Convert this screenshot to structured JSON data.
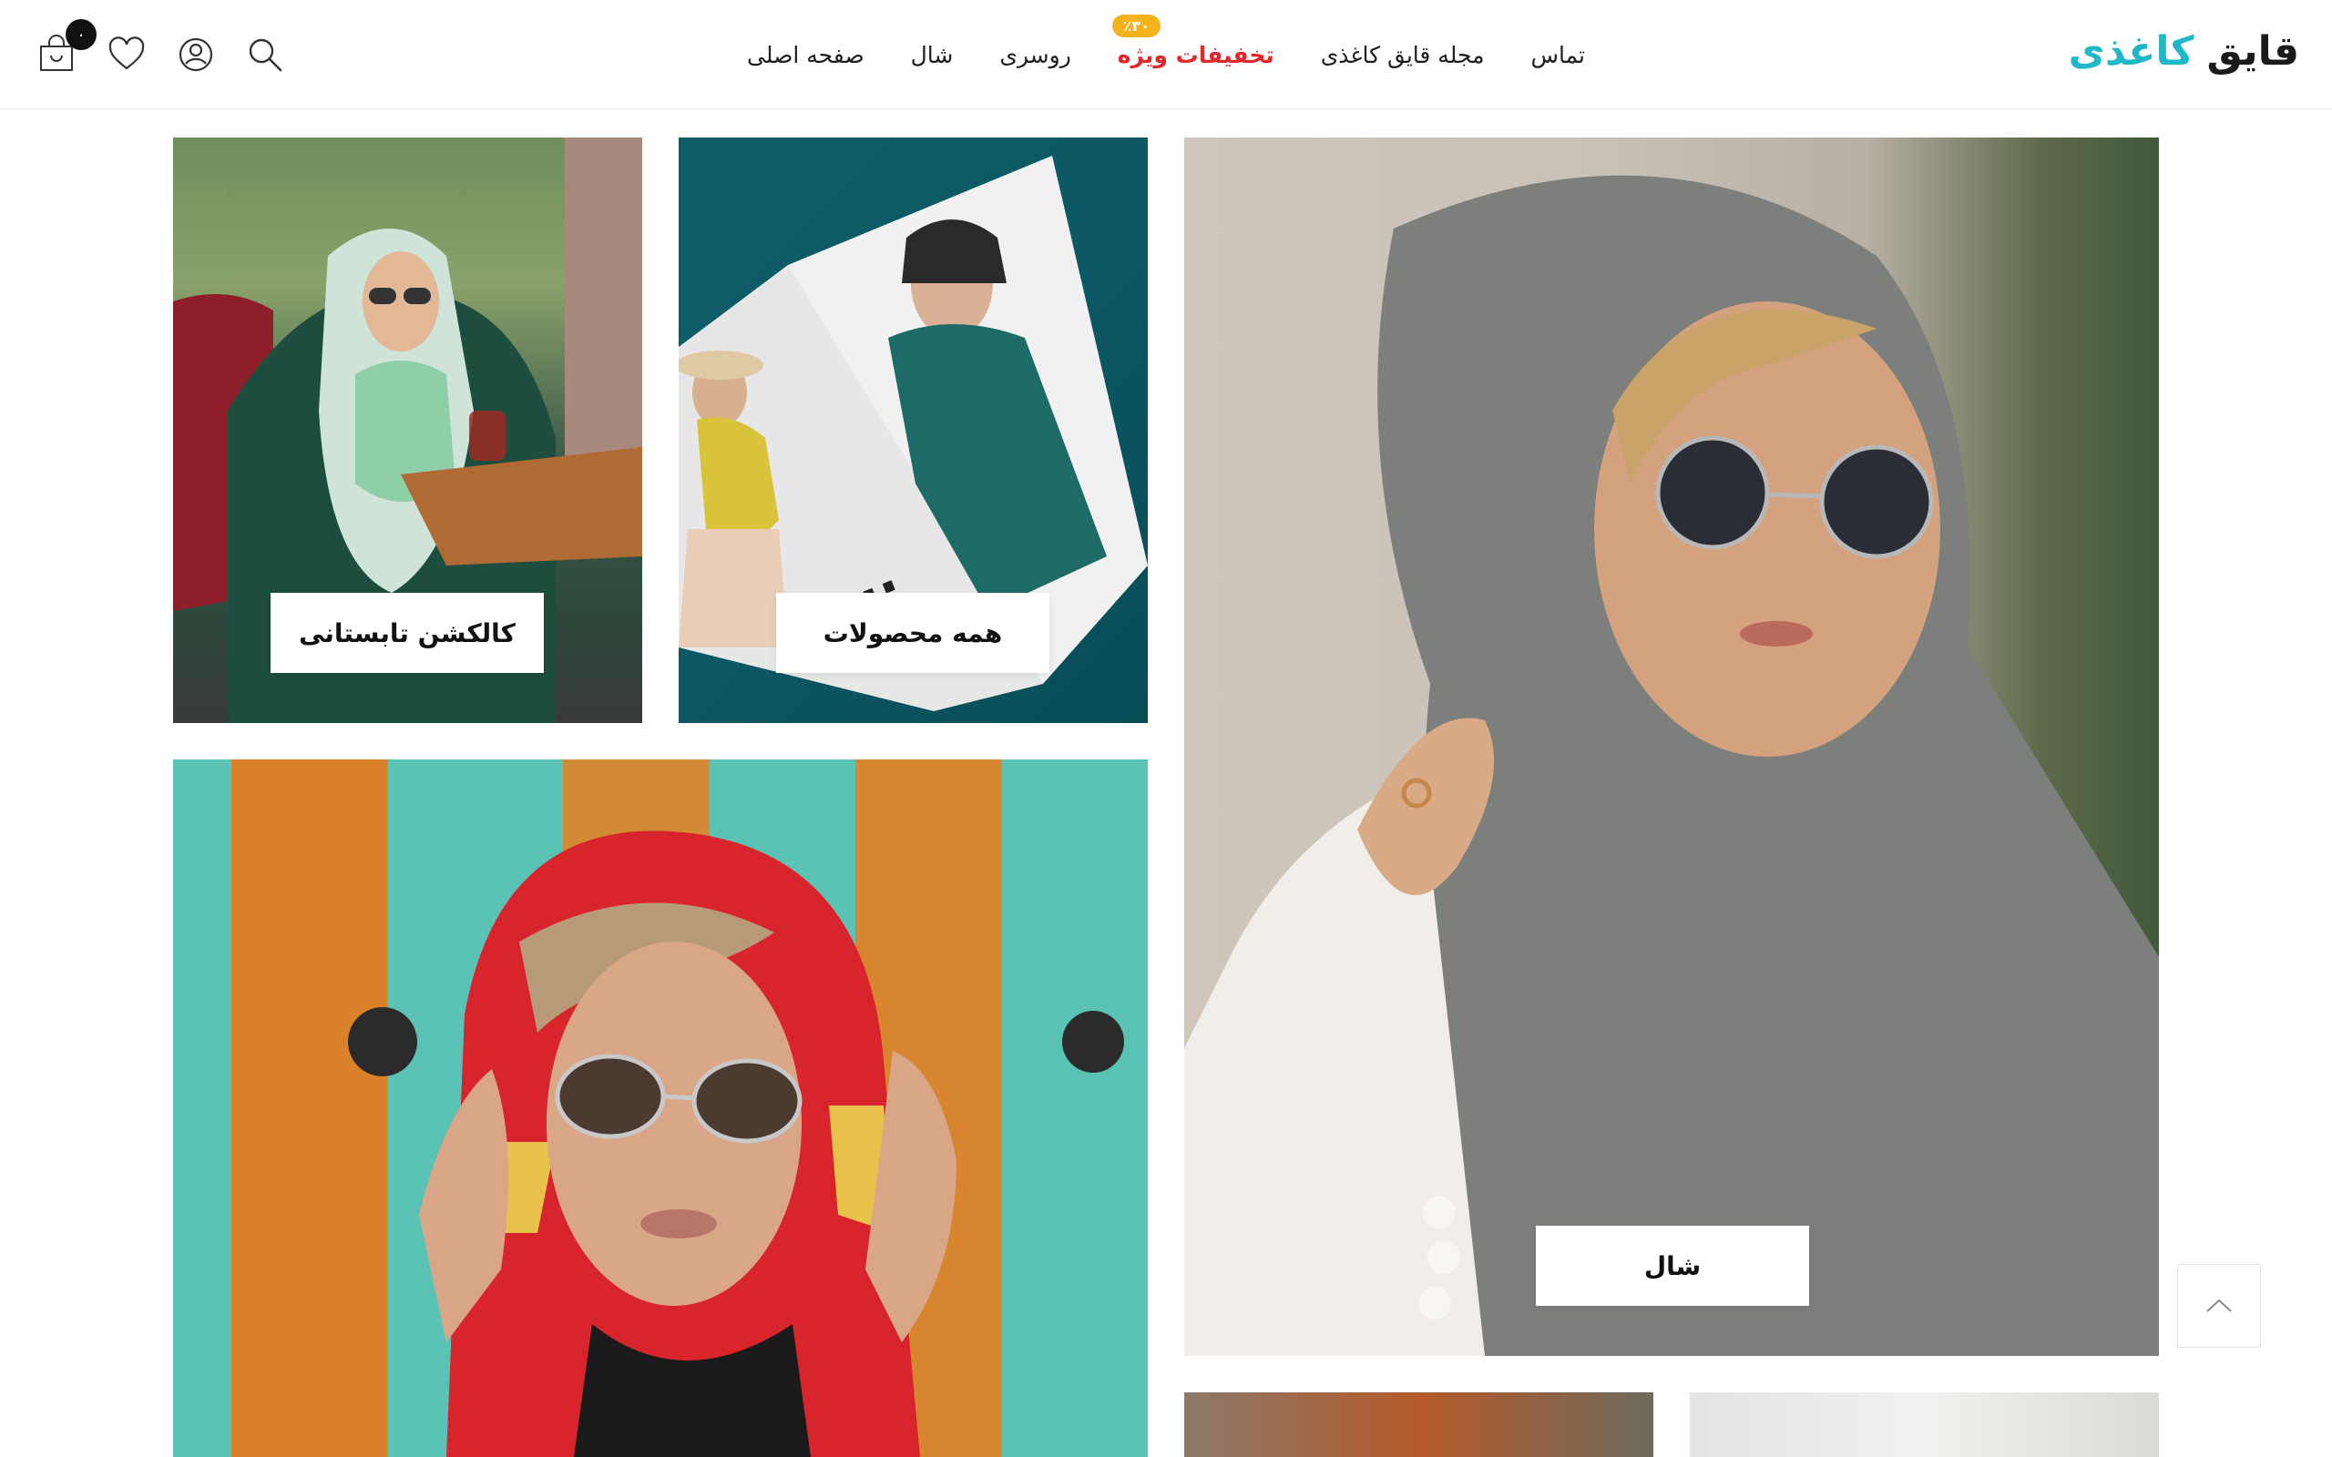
{
  "brand": {
    "name_part1": "قایق",
    "name_part2": "کاغذی"
  },
  "nav": {
    "items": [
      {
        "label": "صفحه اصلی"
      },
      {
        "label": "شال"
      },
      {
        "label": "روسری"
      },
      {
        "label": "تخفیفات ویژه",
        "badge": "٪۳۰"
      },
      {
        "label": "مجله قایق کاغذی"
      },
      {
        "label": "تماس"
      }
    ]
  },
  "header_icons": {
    "cart_count": "۰"
  },
  "banners": {
    "shawl": "شال",
    "summer": "کالکشن تابستانی",
    "all_products": "همه محصولات"
  },
  "colors": {
    "accent": "#20b8c8",
    "special": "#e2262a",
    "badge": "#f6b21b"
  }
}
